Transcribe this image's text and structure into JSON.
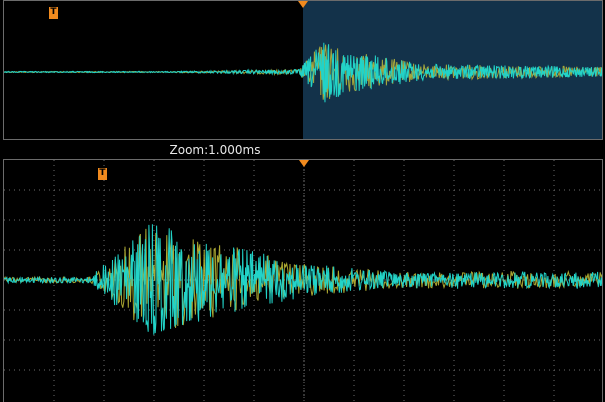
{
  "zoom_label": "Zoom:1.000ms",
  "trigger_marker": "T",
  "colors": {
    "trace_primary": "#22d3c8",
    "trace_secondary": "#c9c43a",
    "zoom_window": "#13324a",
    "grid": "#6b6b6b",
    "marker": "#f08a1e"
  }
}
